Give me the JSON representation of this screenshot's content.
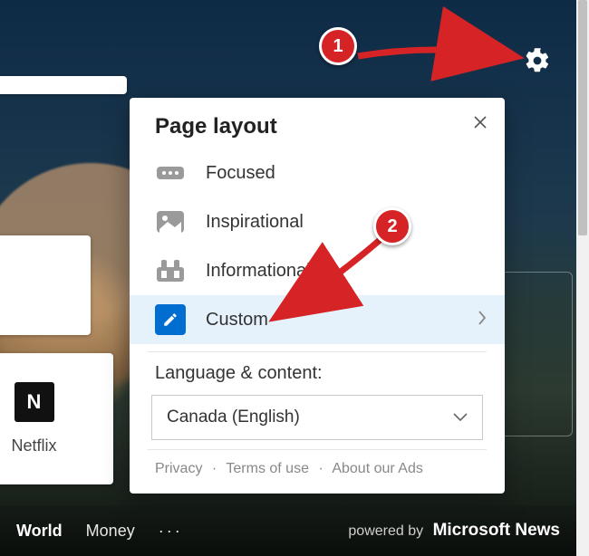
{
  "gear": {
    "name": "settings-gear"
  },
  "tiles": {
    "netflix_letter": "N",
    "netflix_label": "Netflix"
  },
  "panel": {
    "title": "Page layout",
    "options": {
      "focused": {
        "label": "Focused"
      },
      "inspirational": {
        "label": "Inspirational"
      },
      "informational": {
        "label": "Informational"
      },
      "custom": {
        "label": "Custom"
      }
    },
    "language_section_label": "Language & content:",
    "language_value": "Canada (English)",
    "footer": {
      "privacy": "Privacy",
      "terms": "Terms of use",
      "ads": "About our Ads"
    }
  },
  "newsbar": {
    "items": {
      "world": "World",
      "money": "Money"
    },
    "more_glyph": "···",
    "powered_prefix": "powered by",
    "powered_brand": "Microsoft News"
  },
  "annotations": {
    "step1": "1",
    "step2": "2"
  }
}
